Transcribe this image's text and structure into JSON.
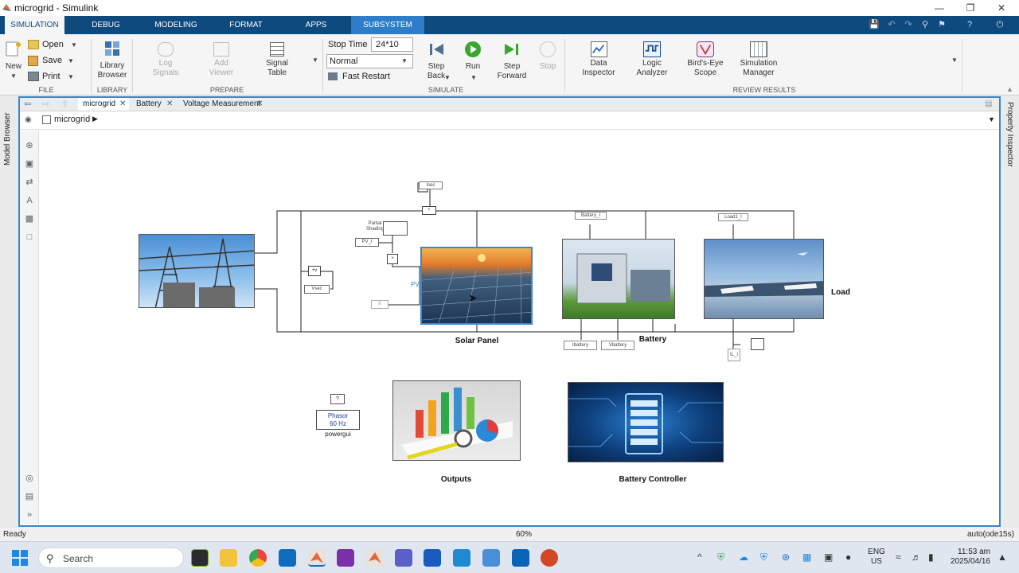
{
  "window": {
    "title": "microgrid - Simulink"
  },
  "ribbon_tabs": [
    {
      "label": "SIMULATION"
    },
    {
      "label": "DEBUG"
    },
    {
      "label": "MODELING"
    },
    {
      "label": "FORMAT"
    },
    {
      "label": "APPS"
    },
    {
      "label": "SUBSYSTEM BLOCK"
    }
  ],
  "file_group": {
    "new_label": "New",
    "open_label": "Open",
    "save_label": "Save",
    "print_label": "Print",
    "group_label": "FILE"
  },
  "library_group": {
    "browser_label_1": "Library",
    "browser_label_2": "Browser",
    "group_label": "LIBRARY"
  },
  "prepare_group": {
    "log_signals_1": "Log",
    "log_signals_2": "Signals",
    "add_viewer_1": "Add",
    "add_viewer_2": "Viewer",
    "signal_table_1": "Signal",
    "signal_table_2": "Table",
    "group_label": "PREPARE"
  },
  "simulate_group": {
    "stop_time_label": "Stop Time",
    "stop_time_value": "24*10",
    "mode_value": "Normal",
    "fast_restart_label": "Fast Restart",
    "step_back_1": "Step",
    "step_back_2": "Back",
    "run_label": "Run",
    "step_forward_1": "Step",
    "step_forward_2": "Forward",
    "stop_label": "Stop",
    "group_label": "SIMULATE"
  },
  "review_group": {
    "data_inspector_1": "Data",
    "data_inspector_2": "Inspector",
    "logic_analyzer_1": "Logic",
    "logic_analyzer_2": "Analyzer",
    "birds_eye_1": "Bird's-Eye",
    "birds_eye_2": "Scope",
    "sim_manager_1": "Simulation",
    "sim_manager_2": "Manager",
    "group_label": "REVIEW RESULTS"
  },
  "side_panels": {
    "left": "Model Browser",
    "right": "Property Inspector"
  },
  "doc_tabs": [
    {
      "label": "microgrid"
    },
    {
      "label": "Battery"
    },
    {
      "label": "Voltage Measurement"
    }
  ],
  "breadcrumb": {
    "model": "microgrid"
  },
  "blocks": {
    "solar_panel": "Solar Panel",
    "battery": "Battery",
    "load": "Load",
    "outputs": "Outputs",
    "battery_controller": "Battery Controller",
    "powergui_name": "powergui",
    "powergui_line1": "Phasor",
    "powergui_line2": "60 Hz",
    "pv_label": "PV",
    "partial_shading_1": "Partial",
    "partial_shading_2": "Shading",
    "pv_i": "PV_I",
    "isec": "Isec",
    "vsec": "Vsec",
    "battery_i": "Battery_I",
    "load_i": "Load1_I",
    "ibattery": "Ibattery",
    "vbattery": "Vbattery",
    "il_i": "IL_I",
    "ir": "Ir",
    "question": "?",
    "sum_sign": "+"
  },
  "status": {
    "left": "Ready",
    "zoom": "60%",
    "solver": "auto(ode15s)"
  },
  "taskbar": {
    "search_placeholder": "Search",
    "lang_1": "ENG",
    "lang_2": "US",
    "time": "11:53 am",
    "date": "2025/04/16"
  }
}
